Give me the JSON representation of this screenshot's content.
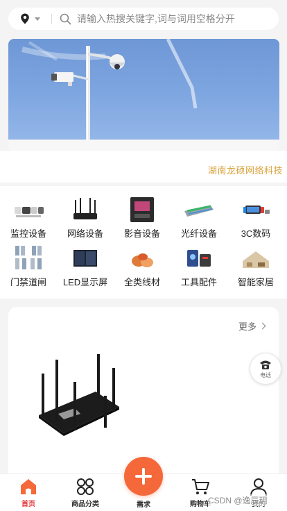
{
  "search": {
    "placeholder": "请输入热搜关键字,词与词用空格分开",
    "location_icon": "location-pin-icon",
    "search_icon": "search-icon"
  },
  "notice": {
    "text": "湖南龙硕网络科技"
  },
  "categories": [
    {
      "label": "监控设备",
      "icon": "cctv-cameras-icon"
    },
    {
      "label": "网络设备",
      "icon": "router-icon"
    },
    {
      "label": "影音设备",
      "icon": "av-device-icon"
    },
    {
      "label": "光纤设备",
      "icon": "fiber-panel-icon"
    },
    {
      "label": "3C数码",
      "icon": "digital-devices-icon"
    },
    {
      "label": "门禁道闸",
      "icon": "access-gate-icon"
    },
    {
      "label": "LED显示屏",
      "icon": "led-screen-icon"
    },
    {
      "label": "全类线材",
      "icon": "cables-icon"
    },
    {
      "label": "工具配件",
      "icon": "tools-icon"
    },
    {
      "label": "智能家居",
      "icon": "smart-home-icon"
    }
  ],
  "product_section": {
    "more_label": "更多"
  },
  "float_phone": {
    "label": "电话",
    "icon": "phone-icon"
  },
  "tabbar": {
    "items": [
      {
        "label": "首页",
        "icon": "home-icon",
        "active": true
      },
      {
        "label": "商品分类",
        "icon": "category-grid-icon",
        "active": false
      },
      {
        "label": "需求",
        "icon": "plus-icon",
        "active": false
      },
      {
        "label": "购物车",
        "icon": "cart-icon",
        "active": false
      },
      {
        "label": "我的",
        "icon": "user-icon",
        "active": false
      }
    ]
  },
  "watermark": "CSDN @逸辰玥",
  "colors": {
    "accent": "#f4683a",
    "active_tab": "#e4393c",
    "notice": "#d9a13a"
  }
}
